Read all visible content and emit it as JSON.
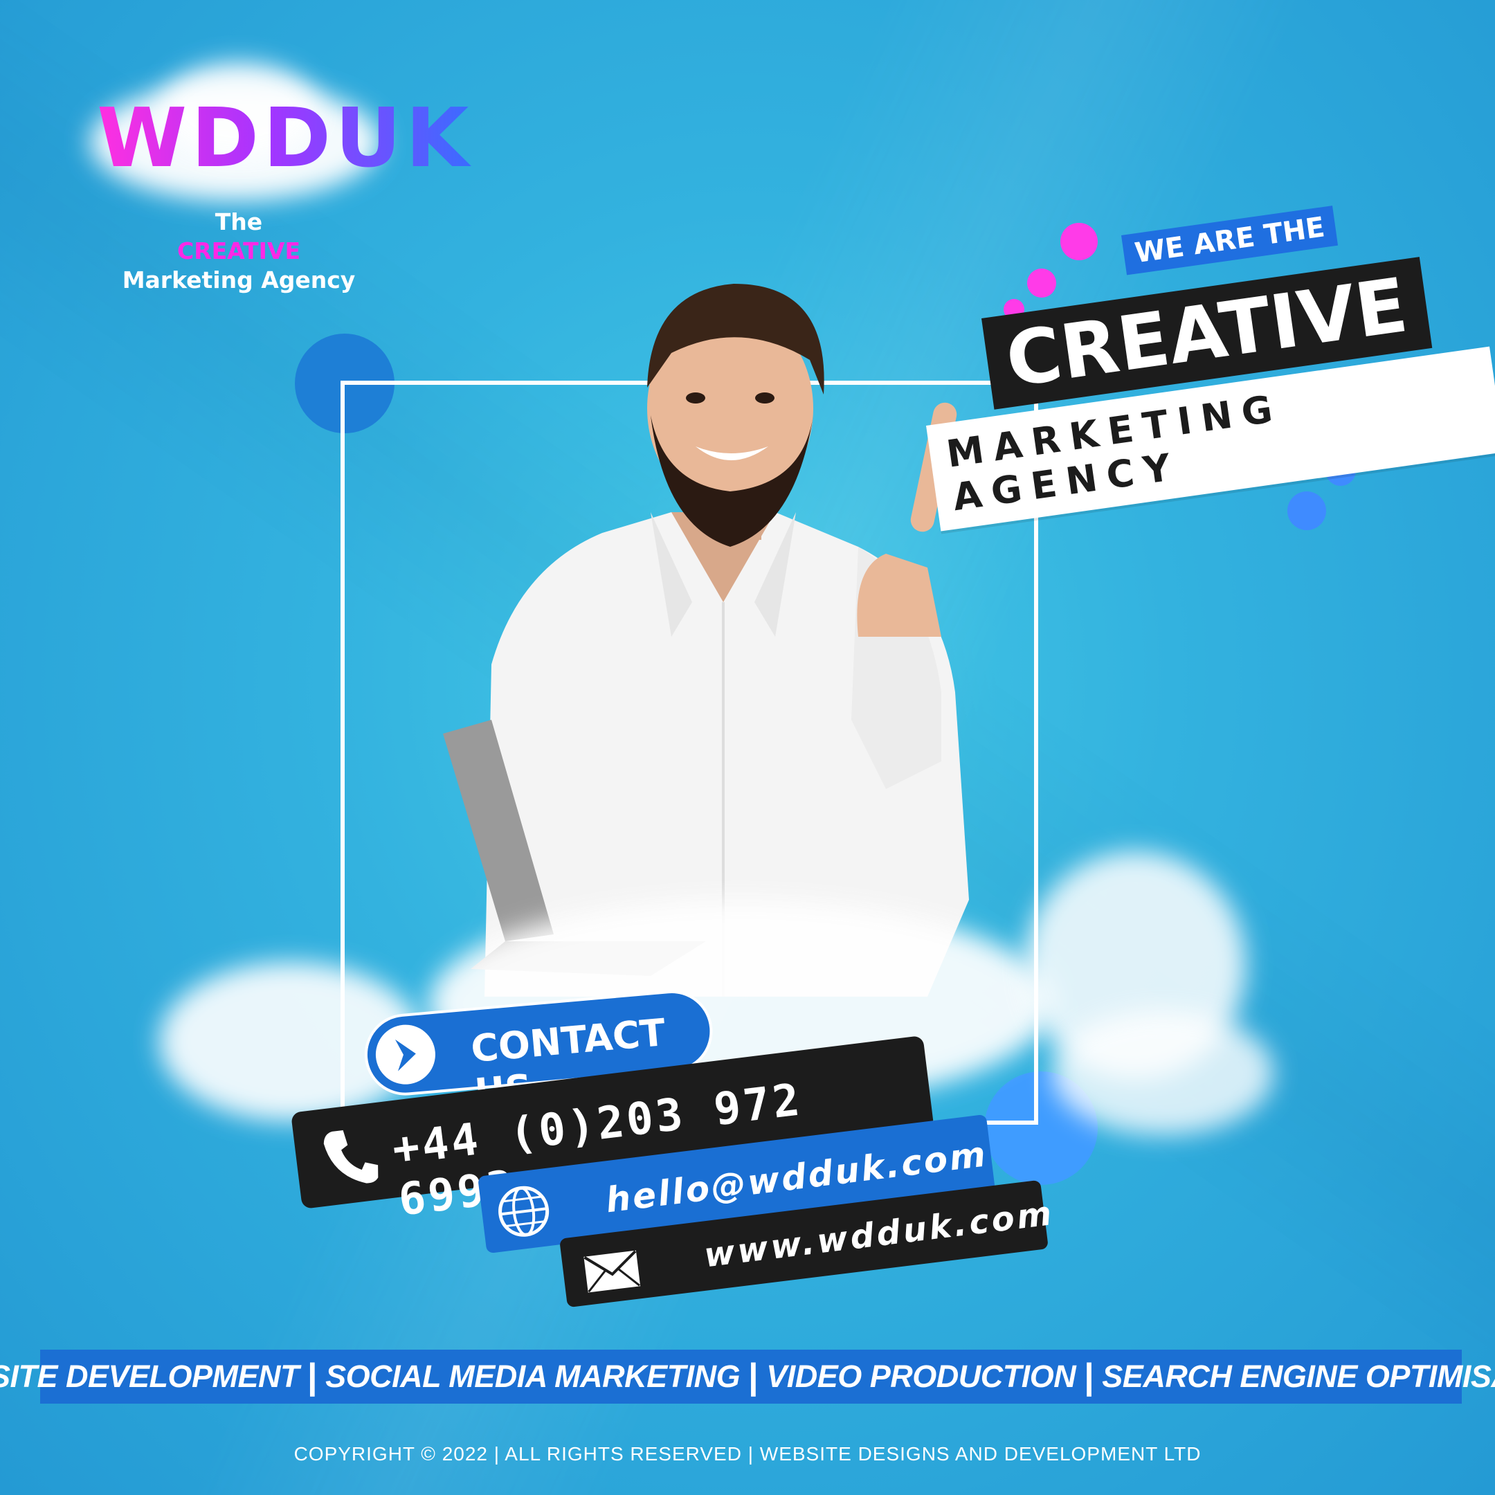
{
  "brand": {
    "logo_text": "WDDUK"
  },
  "tagline": {
    "line1": "The",
    "line2": "CREATIVE",
    "line3": "Marketing Agency"
  },
  "headline": {
    "small": "WE ARE THE",
    "big": "CREATIVE",
    "sub": "MARKETING AGENCY"
  },
  "contact": {
    "button_label": "CONTACT US",
    "phone": "+44 (0)203 972 6993",
    "email": "hello@wdduk.com",
    "website": "www.wdduk.com"
  },
  "services": [
    "WEBSITE DEVELOPMENT",
    "SOCIAL MEDIA MARKETING",
    "VIDEO PRODUCTION",
    "SEARCH ENGINE OPTIMISATION"
  ],
  "services_separator": "|",
  "footer": {
    "copyright": "COPYRIGHT © 2022 | ALL RIGHTS RESERVED | WEBSITE DESIGNS AND DEVELOPMENT LTD"
  },
  "colors": {
    "background": "#33b2df",
    "accent_blue": "#1b6fd3",
    "accent_pink": "#ff28e6",
    "dark_bar": "#1c1c1c"
  },
  "icons": [
    "arrow-right-icon",
    "phone-icon",
    "globe-icon",
    "envelope-icon"
  ]
}
